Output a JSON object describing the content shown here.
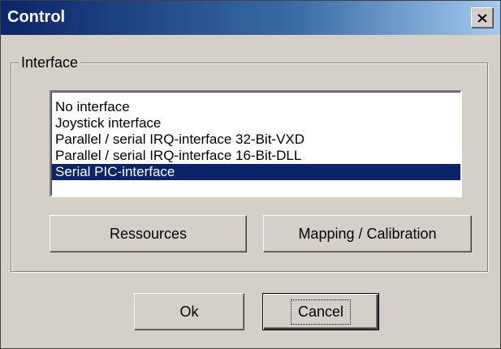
{
  "window": {
    "title": "Control",
    "close_icon": "close-icon"
  },
  "interface_group": {
    "label": "Interface",
    "items": [
      {
        "label": "No interface",
        "selected": false
      },
      {
        "label": "Joystick interface",
        "selected": false
      },
      {
        "label": "Parallel / serial IRQ-interface 32-Bit-VXD",
        "selected": false
      },
      {
        "label": "Parallel / serial IRQ-interface 16-Bit-DLL",
        "selected": false
      },
      {
        "label": "Serial PIC-interface",
        "selected": true
      }
    ],
    "buttons": {
      "ressources": "Ressources",
      "mapping": "Mapping / Calibration"
    }
  },
  "footer": {
    "ok": "Ok",
    "cancel": "Cancel"
  },
  "colors": {
    "titlebar_start": "#0a246a",
    "titlebar_end": "#a6caf0",
    "selection": "#0a246a",
    "face": "#d4d0c8"
  }
}
